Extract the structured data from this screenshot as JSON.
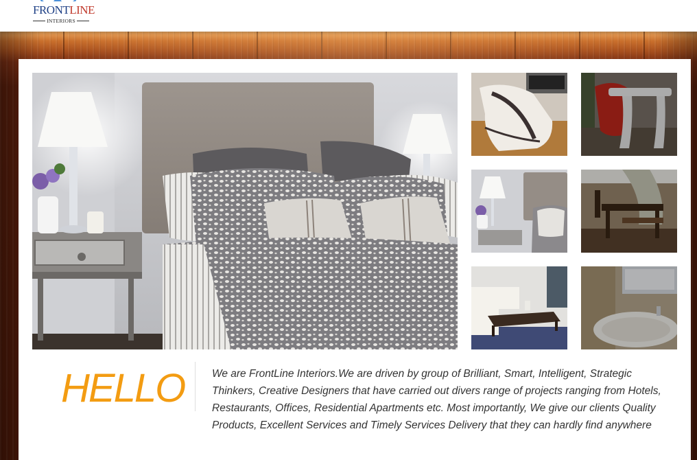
{
  "brand": {
    "name_part1": "FRONT",
    "name_part2": "LINE",
    "tagline": "INTERIORS",
    "colors": {
      "navy": "#1d3f85",
      "red": "#c0392b"
    }
  },
  "gallery": {
    "main": {
      "icon": "bedroom-photo"
    },
    "thumbnails": [
      {
        "icon": "lounge-chair-photo",
        "dimmed": false
      },
      {
        "icon": "red-chair-table-photo",
        "dimmed": true
      },
      {
        "icon": "bedroom-photo",
        "dimmed": false
      },
      {
        "icon": "wooden-chair-photo",
        "dimmed": true
      },
      {
        "icon": "living-room-photo",
        "dimmed": false
      },
      {
        "icon": "bathtub-photo",
        "dimmed": true
      }
    ]
  },
  "intro": {
    "heading": "HELLO",
    "text": "We are FrontLine Interiors.We are driven by group of Brilliant, Smart, Intelligent, Strategic Thinkers, Creative Designers that have carried out divers range of projects ranging from Hotels, Restaurants, Offices, Residential Apartments etc. Most importantly, We give our clients Quality Products, Excellent Services and Timely Services Delivery that they can hardly find anywhere"
  },
  "colors": {
    "accent": "#f39c12",
    "wood": "#7a2f14"
  }
}
